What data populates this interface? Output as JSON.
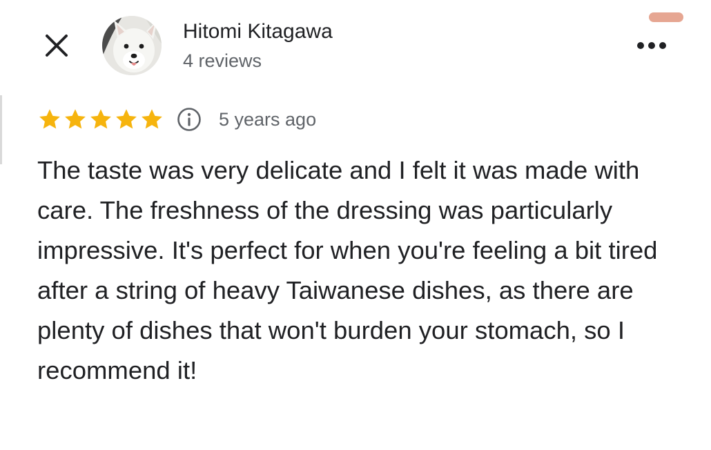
{
  "author": {
    "name": "Hitomi Kitagawa",
    "review_count": "4 reviews"
  },
  "review": {
    "rating": 5,
    "rating_max": 5,
    "date": "5 years ago",
    "text": "The taste was very delicate and I felt it was made with care. The freshness of the dressing was particularly impressive. It's perfect for when you're feeling a bit tired after a string of heavy Taiwanese dishes, as there are plenty of dishes that won't burden your stomach, so I recommend it!"
  },
  "icons": {
    "close": "close-icon",
    "more": "more-options-icon",
    "star": "star-icon",
    "info": "info-icon"
  },
  "colors": {
    "star": "#F6B40E",
    "text_primary": "#202124",
    "text_secondary": "#5f6368"
  }
}
